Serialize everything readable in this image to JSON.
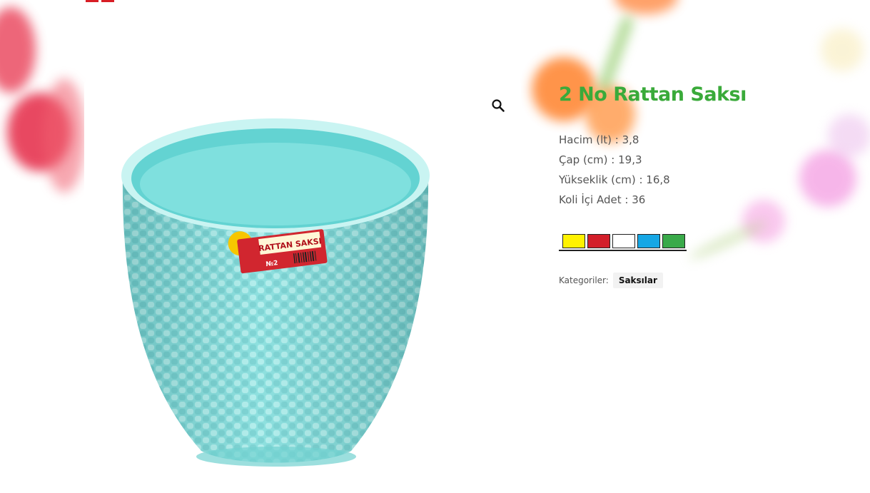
{
  "product": {
    "title": "2 No Rattan Saksı",
    "specs": [
      "Hacim (lt) : 3,8",
      "Çap (cm) : 19,3",
      "Yükseklik (cm) : 16,8",
      "Koli İçi Adet : 36"
    ],
    "colors": [
      "#fff200",
      "#d31f2a",
      "#ffffff",
      "#16a7e5",
      "#3aaa4a"
    ],
    "categories_label": "Kategoriler:",
    "category": "Saksılar"
  },
  "image": {
    "label_brand": "RATTAN SAKSI",
    "label_number": "№2",
    "pot_color": "#8fe2e0"
  },
  "icons": {
    "zoom": "magnifier-icon"
  }
}
